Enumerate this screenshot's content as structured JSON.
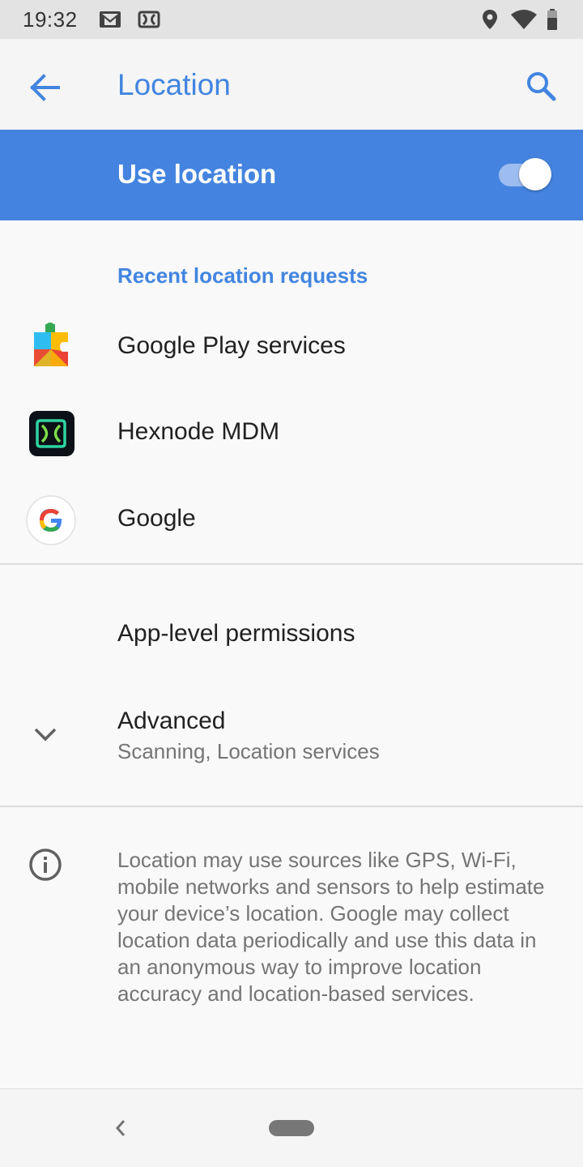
{
  "status_bar": {
    "time": "19:32",
    "left_icons": [
      "gmail-icon",
      "hexnode-icon"
    ],
    "right_icons": [
      "location-icon",
      "wifi-icon",
      "battery-icon"
    ]
  },
  "app_bar": {
    "title": "Location",
    "back_icon": "back-arrow-icon",
    "search_icon": "search-icon"
  },
  "master_switch": {
    "label": "Use location",
    "state": "on"
  },
  "recent_requests": {
    "header": "Recent location requests",
    "apps": [
      {
        "label": "Google Play services",
        "icon": "google-play-services-icon"
      },
      {
        "label": "Hexnode MDM",
        "icon": "hexnode-mdm-icon"
      },
      {
        "label": "Google",
        "icon": "google-icon"
      }
    ]
  },
  "permissions": {
    "app_level_title": "App-level permissions",
    "advanced_title": "Advanced",
    "advanced_summary": "Scanning, Location services"
  },
  "footer": {
    "info_icon": "info-icon",
    "text": "Location may use sources like GPS, Wi-Fi, mobile networks and sensors to help estimate your device’s location. Google may collect location data periodically and use this data in an anonymous way to improve location accuracy and location-based services."
  },
  "colors": {
    "accent": "#4285e0",
    "master_bar": "#4484e0",
    "switch_track": "#9dbcef",
    "status_bar": "#e3e3e3"
  }
}
